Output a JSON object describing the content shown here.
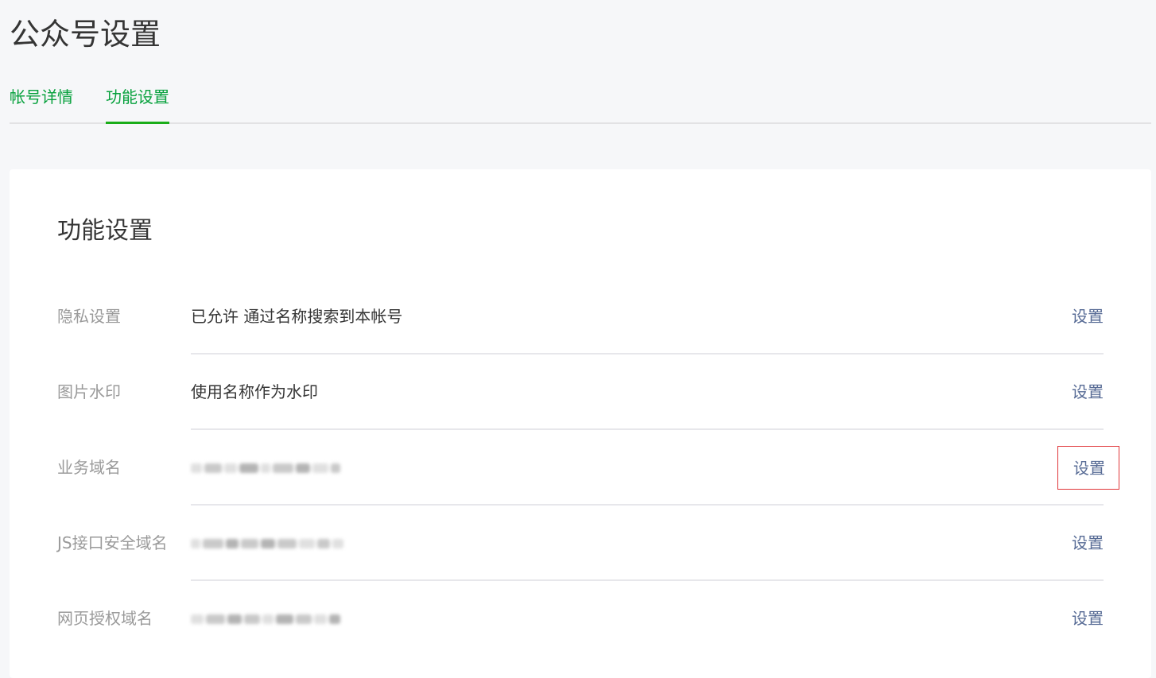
{
  "page": {
    "title": "公众号设置"
  },
  "tabs": [
    {
      "label": "帐号详情",
      "active": false
    },
    {
      "label": "功能设置",
      "active": true
    }
  ],
  "card": {
    "title": "功能设置",
    "rows": [
      {
        "label": "隐私设置",
        "value": "已允许 通过名称搜索到本帐号",
        "action": "设置"
      },
      {
        "label": "图片水印",
        "value": "使用名称作为水印",
        "action": "设置"
      },
      {
        "label": "业务域名",
        "value": "",
        "value_redacted": true,
        "action": "设置",
        "action_highlighted": true
      },
      {
        "label": "JS接口安全域名",
        "value": "",
        "value_redacted": true,
        "action": "设置"
      },
      {
        "label": "网页授权域名",
        "value": "",
        "value_redacted": true,
        "action": "设置"
      }
    ]
  },
  "colors": {
    "accent_green": "#07a13d",
    "link_blue": "#576b95",
    "highlight_red": "#e0363a",
    "page_bg": "#f6f7f9"
  }
}
